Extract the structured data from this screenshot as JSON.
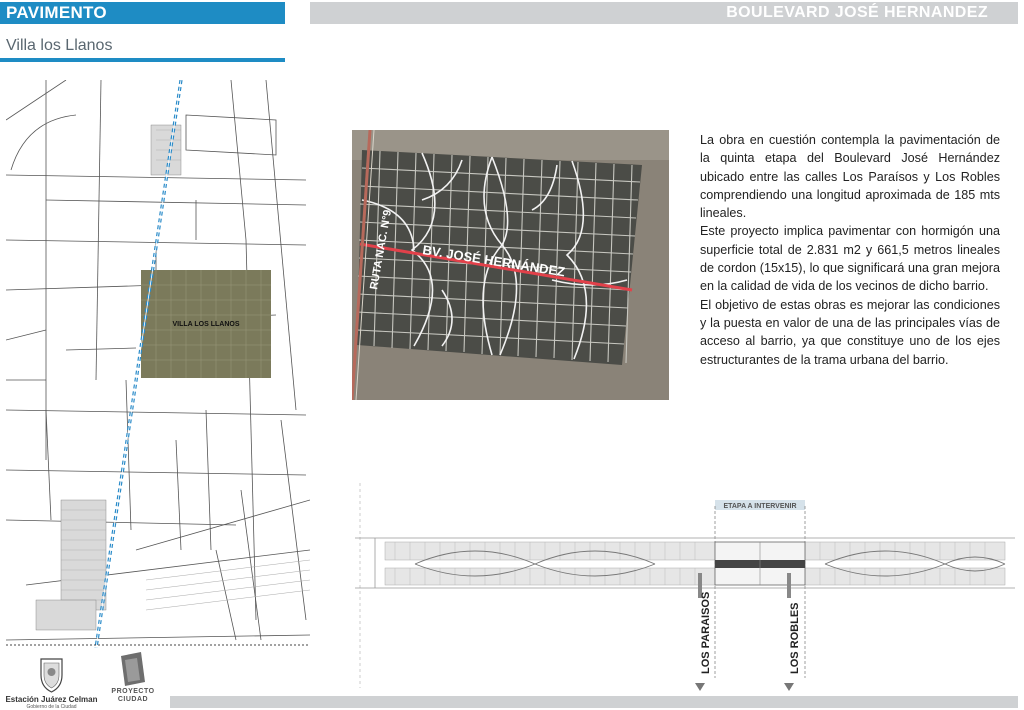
{
  "header": {
    "section": "PAVIMENTO",
    "project": "BOULEVARD JOSÉ HERNANDEZ",
    "location": "Villa los Llanos"
  },
  "map": {
    "area_label": "VILLA LOS LLANOS"
  },
  "photo": {
    "road_label": "RUTA NAC. N°9",
    "boulevard_label": "BV. JOSÉ HERNÁNDEZ"
  },
  "description": {
    "paragraphs": [
      "La obra en cuestión contempla la pavimentación de la quinta etapa del Boulevard José Hernández ubicado entre las calles Los Paraísos y Los Robles comprendiendo una longitud aproximada de 185 mts lineales.",
      "Este proyecto implica pavimentar con hormigón una superficie total de 2.831 m2 y 661,5 metros lineales de cordon (15x15), lo que significará una gran mejora en la calidad de vida de los vecinos de dicho barrio.",
      "El objetivo de estas obras es mejorar las condiciones y la puesta en valor de una de las principales vías de acceso al barrio, ya que constituye uno de los ejes estructurantes de la trama urbana del barrio."
    ]
  },
  "plan": {
    "stage_label": "ETAPA A INTERVENIR",
    "street_left": "LOS PARAISOS",
    "street_right": "LOS ROBLES"
  },
  "footer": {
    "logo1_name": "Estación Juárez Celman",
    "logo1_sub": "Gobierno de la Ciudad",
    "logo2_line1": "PROYECTO",
    "logo2_line2": "CIUDAD"
  },
  "colors": {
    "accent": "#1e8cc4",
    "header_grey": "#cfd1d3",
    "boulevard_red": "#e2414a"
  }
}
